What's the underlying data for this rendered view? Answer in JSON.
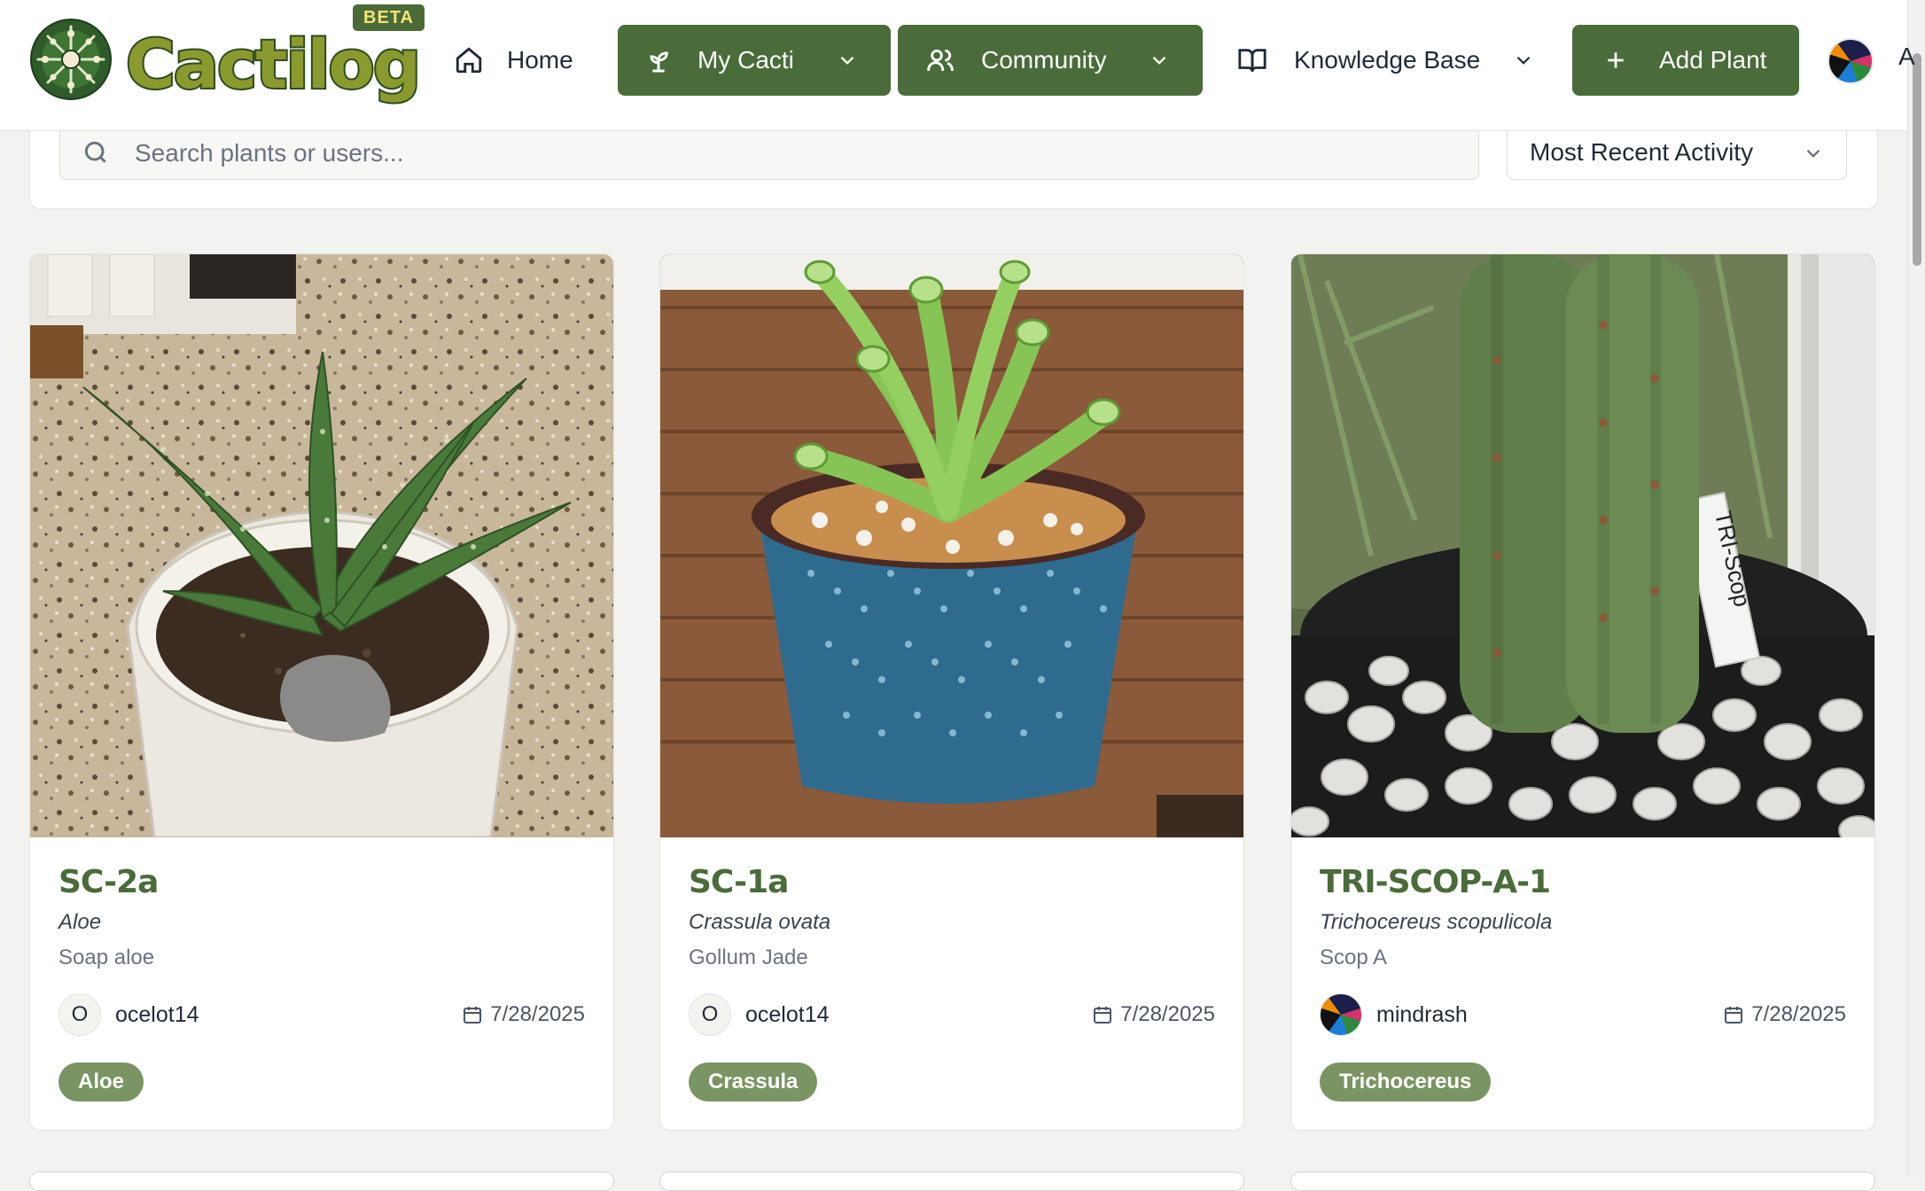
{
  "brand": {
    "name": "Cactilog",
    "badge": "BETA",
    "colors": {
      "primary": "#4a6b3a",
      "tag": "#7a9463",
      "wordmark": "#8a9a2e"
    }
  },
  "nav": {
    "home": {
      "label": "Home",
      "icon": "home-icon"
    },
    "my_cacti": {
      "label": "My Cacti",
      "icon": "sprout-icon"
    },
    "community": {
      "label": "Community",
      "icon": "users-icon"
    },
    "knowledge_base": {
      "label": "Knowledge Base",
      "icon": "book-open-icon"
    },
    "add_plant": {
      "label": "Add Plant",
      "icon": "plus-icon"
    },
    "edge_text": "A"
  },
  "filters": {
    "search_placeholder": "Search plants or users...",
    "search_value": "",
    "sort_selected": "Most Recent Activity"
  },
  "plants": [
    {
      "name": "SC-2a",
      "species": "Aloe",
      "common_name": "Soap aloe",
      "owner_initial": "O",
      "owner": "ocelot14",
      "date": "7/28/2025",
      "tag": "Aloe",
      "photo": "aloe-in-white-pot"
    },
    {
      "name": "SC-1a",
      "species": "Crassula ovata",
      "common_name": "Gollum Jade",
      "owner_initial": "O",
      "owner": "ocelot14",
      "date": "7/28/2025",
      "tag": "Crassula",
      "photo": "jade-in-blue-pot"
    },
    {
      "name": "TRI-SCOP-A-1",
      "species": "Trichocereus scopulicola",
      "common_name": "Scop A",
      "owner_initial": "",
      "owner": "mindrash",
      "date": "7/28/2025",
      "tag": "Trichocereus",
      "photo": "columnar-cactus-in-black-pot",
      "photo_label_text": "TRI-Scop"
    }
  ]
}
